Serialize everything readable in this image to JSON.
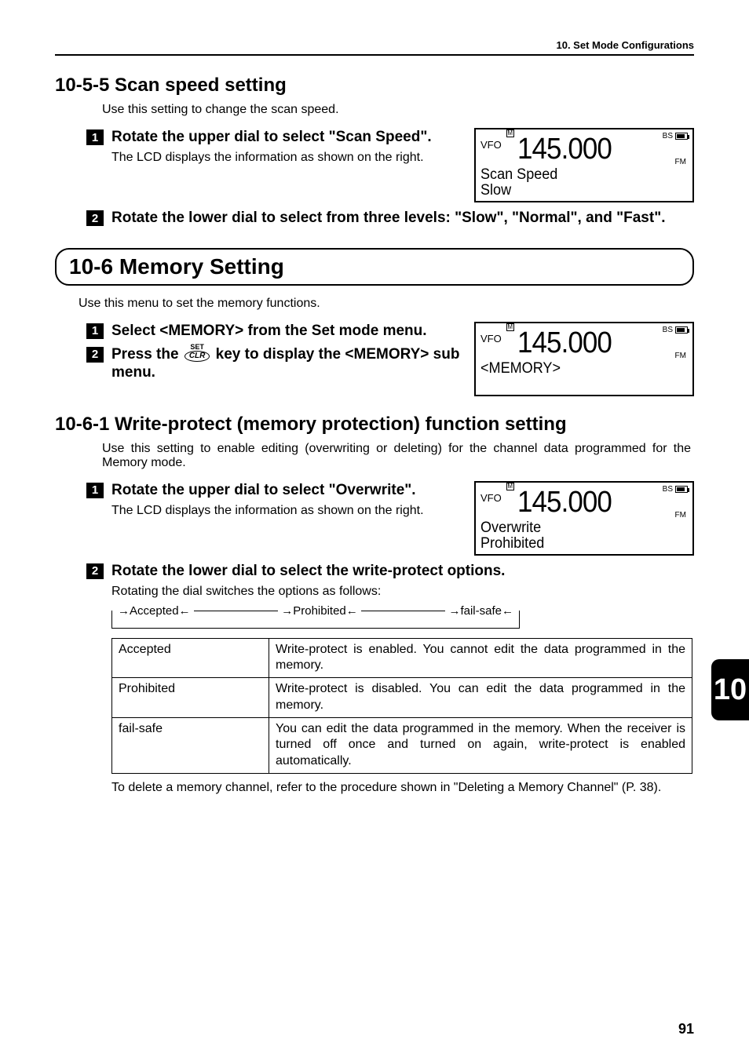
{
  "header": {
    "chapter": "10. Set Mode Configurations"
  },
  "sec1": {
    "title": "10-5-5 Scan speed setting",
    "intro": "Use this setting to change the scan speed.",
    "step1": {
      "num": "1",
      "bold": "Rotate the upper dial to select \"Scan Speed\".",
      "sub": "The LCD displays the information as shown on the right."
    },
    "lcd1": {
      "vfo": "VFO",
      "m": "M",
      "freq": "145.000",
      "bs": "BS",
      "fm": "FM",
      "line1": "Scan Speed",
      "line2": "Slow"
    },
    "step2": {
      "num": "2",
      "bold": "Rotate the lower dial to select from three levels: \"Slow\", \"Normal\", and \"Fast\"."
    }
  },
  "sec2": {
    "title": "10-6 Memory Setting",
    "intro": "Use this menu to set the memory functions.",
    "step1": {
      "num": "1",
      "bold": "Select <MEMORY> from the Set mode menu."
    },
    "step2": {
      "num": "2",
      "bold_a": "Press the ",
      "key_set": "SET",
      "key_clr": "CLR",
      "bold_b": " key to display the <MEMORY> sub menu."
    },
    "lcd": {
      "vfo": "VFO",
      "m": "M",
      "freq": "145.000",
      "bs": "BS",
      "fm": "FM",
      "line1": "<MEMORY>",
      "line2": ""
    }
  },
  "sec3": {
    "title": "10-6-1 Write-protect (memory protection) function setting",
    "intro": "Use this setting to enable editing (overwriting or deleting) for the channel data programmed for the Memory mode.",
    "step1": {
      "num": "1",
      "bold": "Rotate the upper dial to select \"Overwrite\".",
      "sub": "The LCD displays the information as shown on the right."
    },
    "lcd": {
      "vfo": "VFO",
      "m": "M",
      "freq": "145.000",
      "bs": "BS",
      "fm": "FM",
      "line1": "Overwrite",
      "line2": "Prohibited"
    },
    "step2": {
      "num": "2",
      "bold": "Rotate the lower dial to select the write-protect options.",
      "sub": "Rotating the dial switches the options as follows:"
    },
    "flow": {
      "a": "Accepted",
      "b": "Prohibited",
      "c": "fail-safe"
    },
    "table": [
      {
        "k": "Accepted",
        "v": "Write-protect is enabled. You cannot edit the data programmed in the memory."
      },
      {
        "k": "Prohibited",
        "v": "Write-protect is disabled. You can edit the data programmed in the memory."
      },
      {
        "k": "fail-safe",
        "v": "You can edit the data programmed in the memory. When the receiver is turned off once and turned on again, write-protect is enabled automatically."
      }
    ],
    "after": "To delete a memory channel, refer to the procedure shown in \"Deleting a Memory Channel\" (P. 38)."
  },
  "sidetab": "10",
  "pagenum": "91"
}
